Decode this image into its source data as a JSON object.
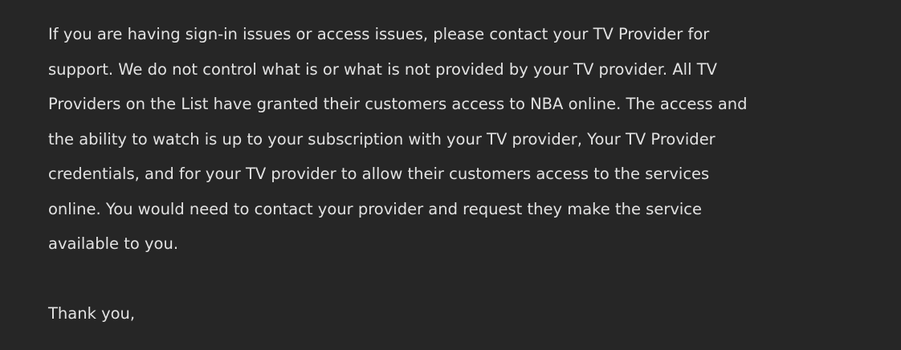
{
  "message": {
    "lines": [
      "If you are having sign-in issues or access issues, please contact your TV Provider for",
      "support. We do not control what is or what is not provided by your TV provider. All TV",
      "Providers on the List have granted their customers access to NBA online. The access and",
      "the ability to watch is up to your subscription with your TV provider, Your TV Provider",
      "credentials, and for your TV provider to allow their customers access to the services",
      "online. You would need to contact your provider and request they make the service",
      "available to you."
    ],
    "closing": "Thank you,"
  }
}
